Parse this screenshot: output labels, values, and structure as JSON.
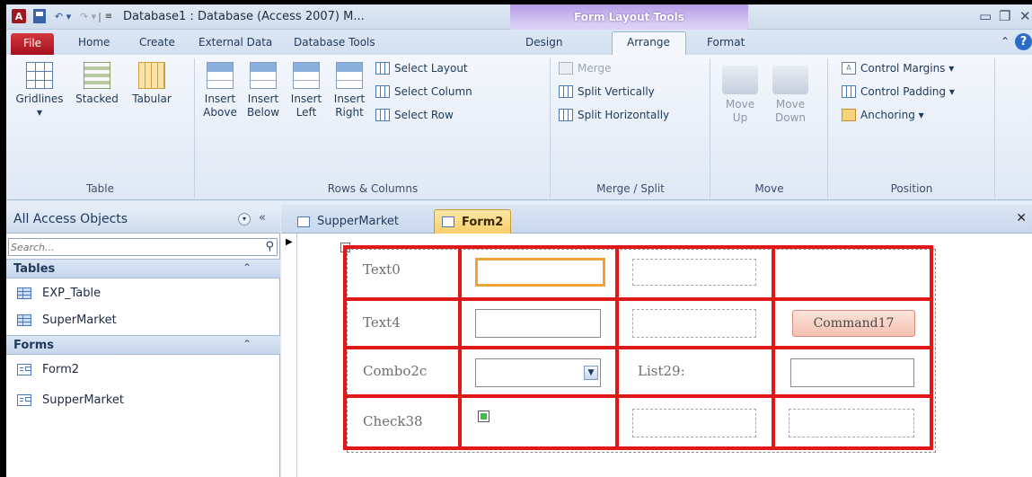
{
  "window": {
    "title": "Database1 : Database (Access 2007) M...",
    "contextual_title": "Form Layout Tools",
    "logo_letter": "A"
  },
  "tabs": {
    "file": "File",
    "home": "Home",
    "create": "Create",
    "external_data": "External Data",
    "database_tools": "Database Tools",
    "design": "Design",
    "arrange": "Arrange",
    "format": "Format",
    "active": "Arrange"
  },
  "ribbon": {
    "table_group": {
      "label": "Table",
      "gridlines": "Gridlines",
      "stacked": "Stacked",
      "tabular": "Tabular"
    },
    "rows_columns_group": {
      "label": "Rows & Columns",
      "insert_above_1": "Insert",
      "insert_above_2": "Above",
      "insert_below_1": "Insert",
      "insert_below_2": "Below",
      "insert_left_1": "Insert",
      "insert_left_2": "Left",
      "insert_right_1": "Insert",
      "insert_right_2": "Right",
      "select_layout": "Select Layout",
      "select_column": "Select Column",
      "select_row": "Select Row"
    },
    "merge_split_group": {
      "label": "Merge / Split",
      "merge": "Merge",
      "split_vertically": "Split Vertically",
      "split_horizontally": "Split Horizontally"
    },
    "move_group": {
      "label": "Move",
      "move_up_1": "Move",
      "move_up_2": "Up",
      "move_down_1": "Move",
      "move_down_2": "Down"
    },
    "position_group": {
      "label": "Position",
      "control_margins": "Control Margins ▾",
      "control_padding": "Control Padding ▾",
      "anchoring": "Anchoring ▾"
    }
  },
  "nav": {
    "title": "All Access Objects",
    "search_placeholder": "Search...",
    "sections": [
      {
        "label": "Tables",
        "items": [
          "EXP_Table",
          "SuperMarket"
        ]
      },
      {
        "label": "Forms",
        "items": [
          "Form2",
          "SupperMarket"
        ]
      }
    ]
  },
  "documents": {
    "tabs": [
      "SupperMarket",
      "Form2"
    ],
    "active": "Form2"
  },
  "form": {
    "labels": {
      "text0": "Text0",
      "text4": "Text4",
      "combo": "Combo2c",
      "list": "List29:",
      "check": "Check38"
    },
    "command_button": "Command17"
  },
  "colors": {
    "layout_highlight": "#e01818",
    "selected_control": "#f0a23a",
    "file_tab": "#b71c25",
    "contextual": "#b59de4"
  }
}
